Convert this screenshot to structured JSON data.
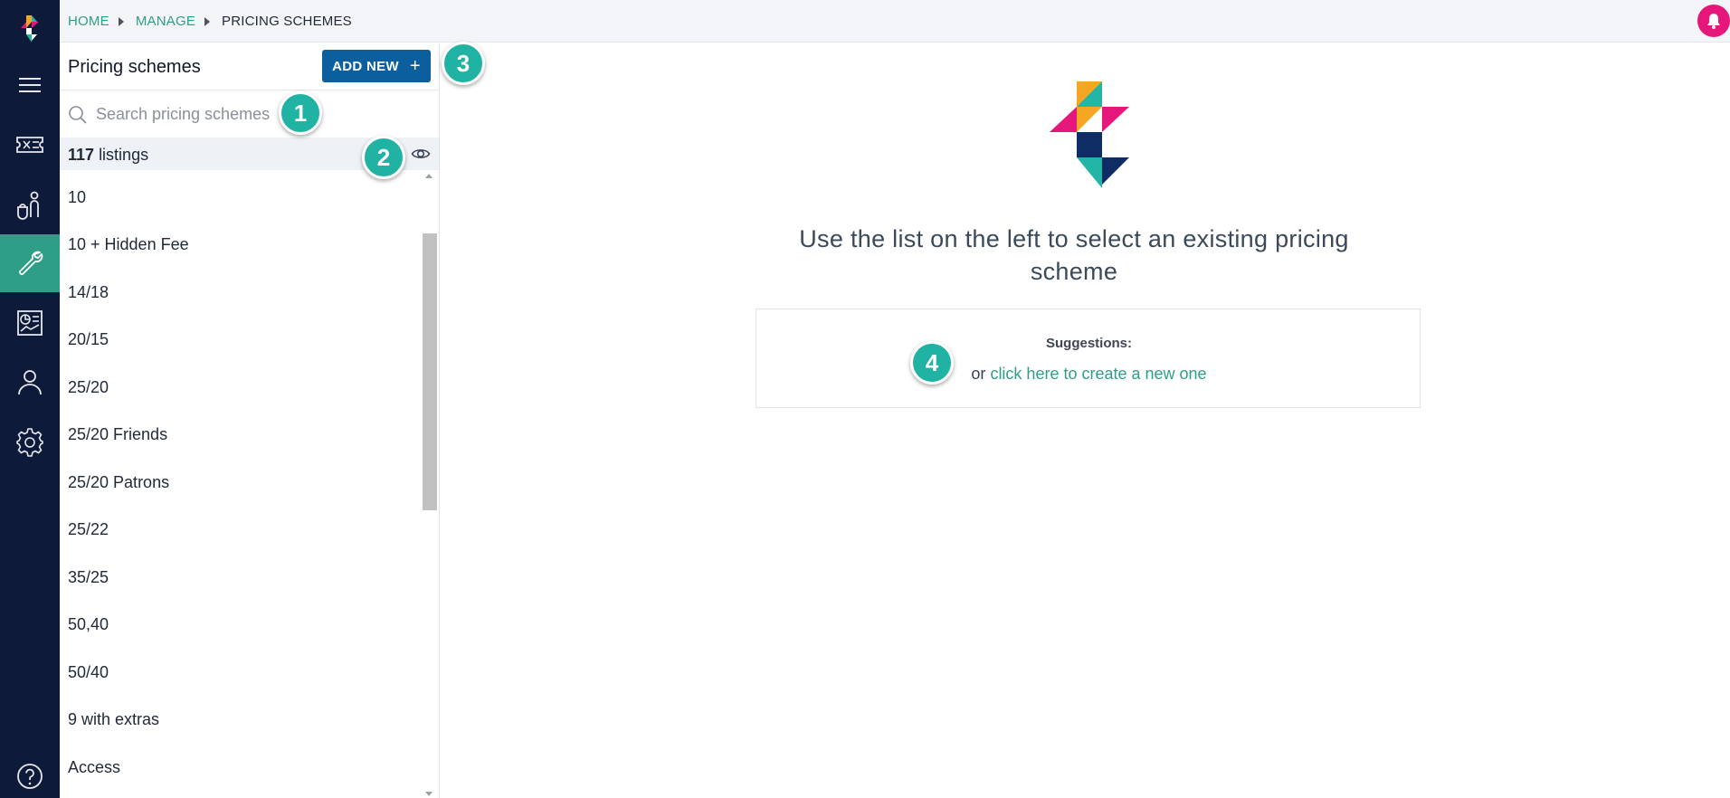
{
  "breadcrumb": {
    "items": [
      {
        "label": "HOME"
      },
      {
        "label": "MANAGE"
      },
      {
        "label": "PRICING SCHEMES"
      }
    ]
  },
  "rail": {
    "icons": [
      "app-logo",
      "menu-icon",
      "ticket-icon",
      "customer-icon",
      "wrench-icon",
      "report-icon",
      "user-icon",
      "gear-icon",
      "help-icon"
    ],
    "active": "wrench-icon",
    "active_color": "#2f9e87",
    "background": "#0e1a3a"
  },
  "notification": {
    "icon": "bell-icon",
    "color": "#e6177a"
  },
  "panel": {
    "title": "Pricing schemes",
    "add_label": "ADD NEW",
    "add_icon": "plus-icon",
    "add_color": "#0b5f9e",
    "search_placeholder": "Search pricing schemes",
    "count": "117",
    "count_suffix": "listings",
    "items": [
      {
        "label": "10"
      },
      {
        "label": "10 + Hidden Fee"
      },
      {
        "label": "14/18"
      },
      {
        "label": "20/15"
      },
      {
        "label": "25/20"
      },
      {
        "label": "25/20 Friends"
      },
      {
        "label": "25/20 Patrons"
      },
      {
        "label": "25/22"
      },
      {
        "label": "35/25"
      },
      {
        "label": "50,40"
      },
      {
        "label": "50/40"
      },
      {
        "label": "9 with extras"
      },
      {
        "label": "Access"
      }
    ]
  },
  "main": {
    "heading": "Use the list on the left to select an existing pricing scheme",
    "suggestions_title": "Suggestions:",
    "or_text": "or",
    "create_link": "click here to create a new one"
  },
  "badges": {
    "one": "1",
    "two": "2",
    "three": "3",
    "four": "4",
    "color": "#20b3a3"
  }
}
